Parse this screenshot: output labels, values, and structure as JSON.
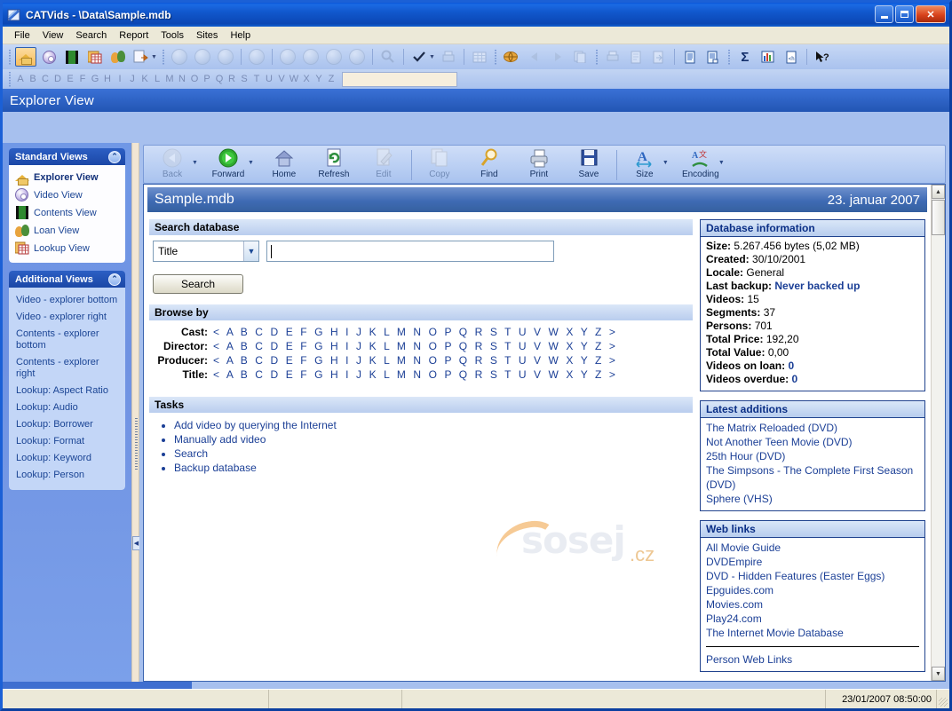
{
  "window": {
    "title": "CATVids - \\Data\\Sample.mdb",
    "icon": "app-icon",
    "minimize": "_",
    "maximize": "□",
    "close": "✕"
  },
  "menubar": [
    {
      "label": "File",
      "accel": "F"
    },
    {
      "label": "View",
      "accel": "V"
    },
    {
      "label": "Search",
      "accel": "S"
    },
    {
      "label": "Report",
      "accel": "R"
    },
    {
      "label": "Tools",
      "accel": "T"
    },
    {
      "label": "Sites",
      "accel": "S"
    },
    {
      "label": "Help",
      "accel": "H"
    }
  ],
  "toolbar": {
    "group1": [
      {
        "name": "explorer-view-icon",
        "selected": true
      },
      {
        "name": "video-view-icon",
        "selected": false
      },
      {
        "name": "contents-view-icon",
        "selected": false
      },
      {
        "name": "lookup-view-icon",
        "selected": false
      },
      {
        "name": "loan-view-icon",
        "selected": false
      },
      {
        "name": "add-video-icon",
        "selected": false,
        "dropdown": true
      }
    ],
    "group2": [
      {
        "name": "first-record-icon"
      },
      {
        "name": "add-record-icon"
      },
      {
        "name": "delete-record-icon"
      },
      {
        "name": "edit-record-icon"
      },
      {
        "name": "nav-first-icon"
      },
      {
        "name": "nav-prev-icon"
      },
      {
        "name": "nav-next-icon"
      },
      {
        "name": "nav-last-icon"
      },
      {
        "name": "find-icon"
      },
      {
        "name": "check-icon",
        "dropdown": true
      },
      {
        "name": "print-preview-icon"
      },
      {
        "name": "grid-icon"
      }
    ],
    "group3": [
      {
        "name": "globe-icon"
      },
      {
        "name": "browse-back-icon"
      },
      {
        "name": "browse-forward-icon"
      },
      {
        "name": "copy-icon"
      }
    ],
    "group4": [
      {
        "name": "print-icon"
      },
      {
        "name": "preview-icon"
      },
      {
        "name": "export-icon"
      },
      {
        "name": "report-icon"
      },
      {
        "name": "report-list-icon"
      }
    ],
    "group5": [
      {
        "name": "sum-icon",
        "glyph": "Σ"
      },
      {
        "name": "chart-icon"
      },
      {
        "name": "html-export-icon"
      },
      {
        "name": "help-pointer-icon"
      }
    ]
  },
  "alphabar": {
    "letters": [
      "A",
      "B",
      "C",
      "D",
      "E",
      "F",
      "G",
      "H",
      "I",
      "J",
      "K",
      "L",
      "M",
      "N",
      "O",
      "P",
      "Q",
      "R",
      "S",
      "T",
      "U",
      "V",
      "W",
      "X",
      "Y",
      "Z"
    ],
    "quick_search_value": ""
  },
  "view_header": {
    "title": "Explorer View"
  },
  "taskpane": {
    "standard": {
      "heading": "Standard Views",
      "collapse": "⌃",
      "items": [
        {
          "label": "Explorer View",
          "icon": "house-icon",
          "active": true
        },
        {
          "label": "Video View",
          "icon": "disc-icon",
          "active": false
        },
        {
          "label": "Contents View",
          "icon": "film-icon",
          "active": false
        },
        {
          "label": "Loan View",
          "icon": "people-icon",
          "active": false
        },
        {
          "label": "Lookup View",
          "icon": "table-icon",
          "active": false
        }
      ]
    },
    "additional": {
      "heading": "Additional Views",
      "collapse": "⌃",
      "items": [
        {
          "label": "Video - explorer bottom"
        },
        {
          "label": "Video - explorer right"
        },
        {
          "label": "Contents - explorer bottom"
        },
        {
          "label": "Contents - explorer right"
        },
        {
          "label": "Lookup: Aspect Ratio"
        },
        {
          "label": "Lookup: Audio"
        },
        {
          "label": "Lookup: Borrower"
        },
        {
          "label": "Lookup: Format"
        },
        {
          "label": "Lookup: Keyword"
        },
        {
          "label": "Lookup: Person"
        }
      ]
    }
  },
  "content_toolbar": [
    {
      "label": "Back",
      "icon": "back-arrow-icon",
      "disabled": true,
      "dropdown": true
    },
    {
      "label": "Forward",
      "icon": "forward-arrow-icon",
      "disabled": false,
      "dropdown": true
    },
    {
      "label": "Home",
      "icon": "home-icon",
      "disabled": false,
      "dropdown": false
    },
    {
      "label": "Refresh",
      "icon": "refresh-icon",
      "disabled": false,
      "dropdown": false
    },
    {
      "label": "Edit",
      "icon": "edit-pencil-icon",
      "disabled": true,
      "dropdown": false
    },
    {
      "label": "Copy",
      "icon": "copy-pages-icon",
      "disabled": true,
      "dropdown": false
    },
    {
      "label": "Find",
      "icon": "magnifier-icon",
      "disabled": false,
      "dropdown": false
    },
    {
      "label": "Print",
      "icon": "printer-icon",
      "disabled": false,
      "dropdown": false
    },
    {
      "label": "Save",
      "icon": "floppy-disk-icon",
      "disabled": false,
      "dropdown": false
    },
    {
      "label": "Size",
      "icon": "font-size-icon",
      "disabled": false,
      "dropdown": true
    },
    {
      "label": "Encoding",
      "icon": "encoding-icon",
      "disabled": false,
      "dropdown": true
    }
  ],
  "page": {
    "header": {
      "title": "Sample.mdb",
      "date": "23. januar 2007"
    },
    "search": {
      "section_title": "Search database",
      "field_selected": "Title",
      "field_options": [
        "Title"
      ],
      "query_value": "",
      "query_placeholder": "",
      "button_label": "Search"
    },
    "browse": {
      "section_title": "Browse by",
      "rows": [
        {
          "label": "Cast:",
          "letters": "< A B C D E F G H I J K L M N O P Q R S T U V W X Y Z >"
        },
        {
          "label": "Director:",
          "letters": "< A B C D E F G H I J K L M N O P Q R S T U V W X Y Z >"
        },
        {
          "label": "Producer:",
          "letters": "< A B C D E F G H I J K L M N O P Q R S T U V W X Y Z >"
        },
        {
          "label": "Title:",
          "letters": "< A B C D E F G H I J K L M N O P Q R S T U V W X Y Z >"
        }
      ]
    },
    "tasks": {
      "section_title": "Tasks",
      "items": [
        "Add video by querying the Internet",
        "Manually add video",
        "Search",
        "Backup database"
      ]
    },
    "database_information": {
      "title": "Database information",
      "rows": [
        {
          "key": "Size:",
          "value": "5.267.456 bytes (5,02 MB)",
          "highlight": false
        },
        {
          "key": "Created:",
          "value": "30/10/2001",
          "highlight": false
        },
        {
          "key": "Locale:",
          "value": "General",
          "highlight": false
        },
        {
          "key": "Last backup:",
          "value": "Never backed up",
          "highlight": true
        },
        {
          "key": "Videos:",
          "value": "15",
          "highlight": false
        },
        {
          "key": "Segments:",
          "value": "37",
          "highlight": false
        },
        {
          "key": "Persons:",
          "value": "701",
          "highlight": false
        },
        {
          "key": "Total Price:",
          "value": "192,20",
          "highlight": false
        },
        {
          "key": "Total Value:",
          "value": "0,00",
          "highlight": false
        },
        {
          "key": "Videos on loan:",
          "value": "0",
          "highlight": true
        },
        {
          "key": "Videos overdue:",
          "value": "0",
          "highlight": true
        }
      ]
    },
    "latest_additions": {
      "title": "Latest additions",
      "items": [
        "The Matrix Reloaded (DVD)",
        "Not Another Teen Movie (DVD)",
        "25th Hour (DVD)",
        "The Simpsons - The Complete First Season (DVD)",
        "Sphere (VHS)"
      ]
    },
    "web_links": {
      "title": "Web links",
      "items": [
        "All Movie Guide",
        "DVDEmpire",
        "DVD - Hidden Features (Easter Eggs)",
        "Epguides.com",
        "Movies.com",
        "Play24.com",
        "The Internet Movie Database"
      ],
      "footer_items": [
        "Person Web Links"
      ]
    },
    "watermark": {
      "text": "sosej",
      "suffix": ".cz"
    }
  },
  "statusbar": {
    "cell1": "",
    "cell2": "",
    "cell3": "",
    "timestamp": "23/01/2007 08:50:00"
  },
  "colors": {
    "accent": "#1b3f96",
    "titlebar": "#0a50d2",
    "taskpane": "#6f92e2",
    "panel_border": "#21438e"
  }
}
